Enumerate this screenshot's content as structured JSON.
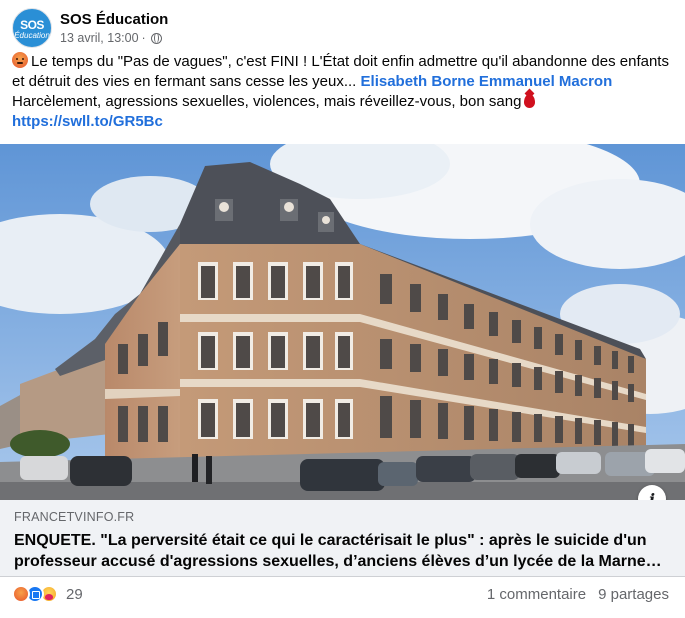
{
  "page": {
    "name": "SOS Éducation",
    "avatar_top": "SOS",
    "avatar_bottom": "Éducation",
    "date": "13 avril, 13:00",
    "separator": "·"
  },
  "post": {
    "line1": "Le temps du \"Pas de vagues\", c'est FINI ! L'État doit enfin admettre qu'il abandonne des enfants et détruit des vies en fermant sans cesse les yeux...",
    "mention1": "Elisabeth Borne",
    "mention2": "Emmanuel Macron",
    "line2": "Harcèlement, agressions sexuelles, violences, mais réveillez-vous, bon sang",
    "url": "https://swll.to/GR5Bc"
  },
  "link_card": {
    "domain": "FRANCETVINFO.FR",
    "headline": "ENQUETE. \"La perversité était ce qui le caractérisait le plus\" : après le suicide d'un professeur accusé d'agressions sexuelles, d’anciens élèves d’un lycée de la Marne…"
  },
  "footer": {
    "reaction_count": "29",
    "comments": "1 commentaire",
    "shares": "9 partages"
  },
  "icons": {
    "info": "i"
  }
}
